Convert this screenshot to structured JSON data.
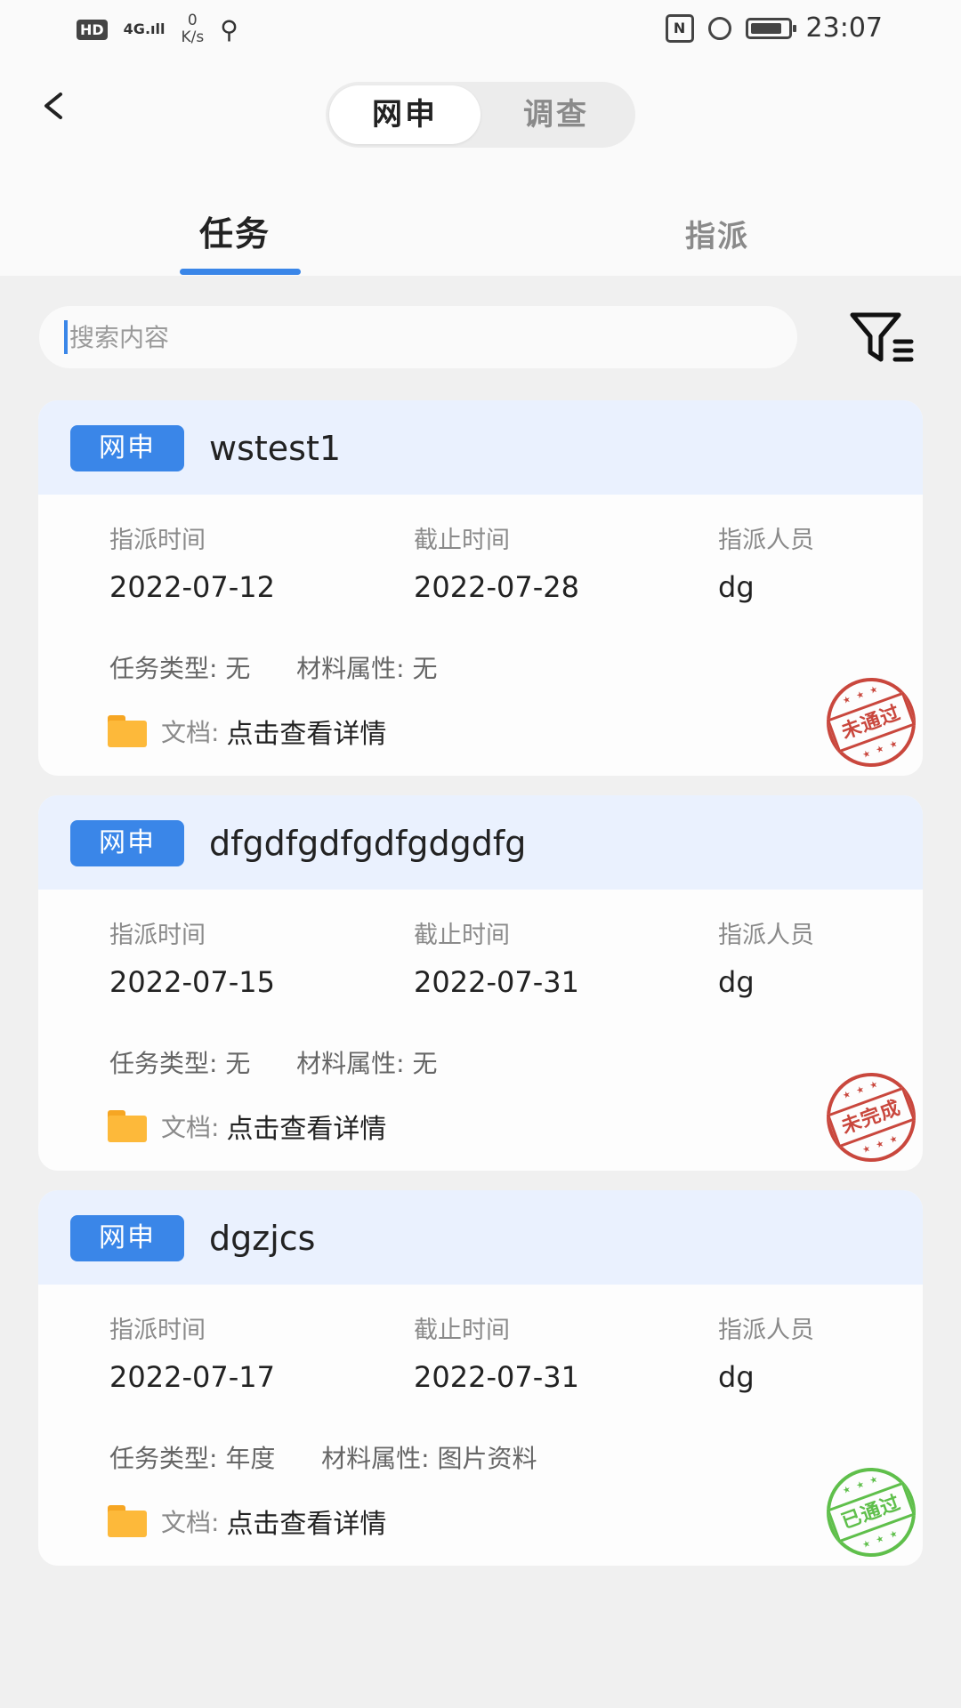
{
  "status_bar": {
    "hd": "HD",
    "signal": "4G",
    "net_speed_value": "0",
    "net_speed_unit": "K/s",
    "nfc": "N",
    "time": "23:07"
  },
  "header": {
    "segments": [
      "网申",
      "调查"
    ],
    "active_segment": "网申"
  },
  "tabs": [
    {
      "label": "任务",
      "active": true
    },
    {
      "label": "指派",
      "active": false
    }
  ],
  "search": {
    "placeholder": "搜索内容"
  },
  "labels": {
    "assign_time": "指派时间",
    "deadline": "截止时间",
    "assignee": "指派人员",
    "task_type": "任务类型:",
    "material": "材料属性:",
    "doc": "文档:",
    "doc_link": "点击查看详情"
  },
  "tasks": [
    {
      "badge": "网申",
      "title": "wstest1",
      "assign_time": "2022-07-12",
      "deadline": "2022-07-28",
      "assignee": "dg",
      "task_type": "无",
      "material": "无",
      "stamp": "未通过",
      "stamp_color": "#c9473d"
    },
    {
      "badge": "网申",
      "title": "dfgdfgdfgdfgdgdfg",
      "assign_time": "2022-07-15",
      "deadline": "2022-07-31",
      "assignee": "dg",
      "task_type": "无",
      "material": "无",
      "stamp": "未完成",
      "stamp_color": "#c9473d"
    },
    {
      "badge": "网申",
      "title": "dgzjcs",
      "assign_time": "2022-07-17",
      "deadline": "2022-07-31",
      "assignee": "dg",
      "task_type": "年度",
      "material": "图片资料",
      "stamp": "已通过",
      "stamp_color": "#5fbf4b"
    }
  ],
  "colors": {
    "accent": "#3a86e8",
    "card_header": "#eaf1fe",
    "background": "#f0f0f0"
  }
}
